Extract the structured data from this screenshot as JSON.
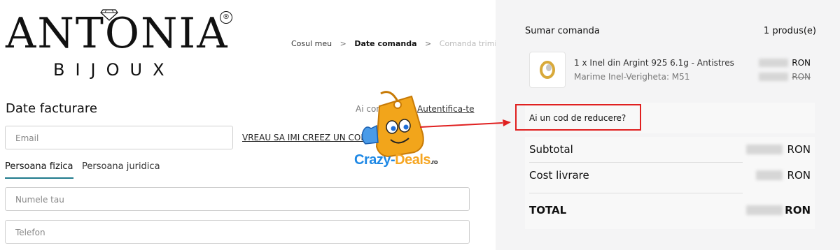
{
  "logo": {
    "brand_main": "ANTONIA",
    "brand_sub": "BIJOUX",
    "registered_mark": "®"
  },
  "breadcrumb": {
    "step1": "Cosul meu",
    "step2": "Date comanda",
    "step3": "Comanda trimisa",
    "separator": ">"
  },
  "billing": {
    "title": "Date facturare",
    "login_prompt": "Ai cont?",
    "login_link": "Autentifica-te",
    "email_placeholder": "Email",
    "create_account_link": "VREAU SA IMI CREEZ UN CONT",
    "tabs": [
      "Persoana fizica",
      "Persoana juridica"
    ],
    "name_placeholder": "Numele tau",
    "phone_placeholder": "Telefon"
  },
  "watermark": {
    "text_main": "Crazy-",
    "text_accent": "Deals",
    "text_suffix": ".ro"
  },
  "summary": {
    "title": "Sumar comanda",
    "count": "1 produs(e)",
    "product_name": "1 x Inel din Argint 925 6.1g - Antistres",
    "product_variant": "Marime Inel-Verigheta: M51",
    "currency": "RON",
    "discount_prompt": "Ai un cod de reducere?",
    "subtotal_label": "Subtotal",
    "shipping_label": "Cost livrare",
    "total_label": "TOTAL"
  },
  "colors": {
    "accent_tab": "#1f7a8c",
    "annotation_red": "#e02020",
    "panel_bg": "#f4f4f5"
  }
}
